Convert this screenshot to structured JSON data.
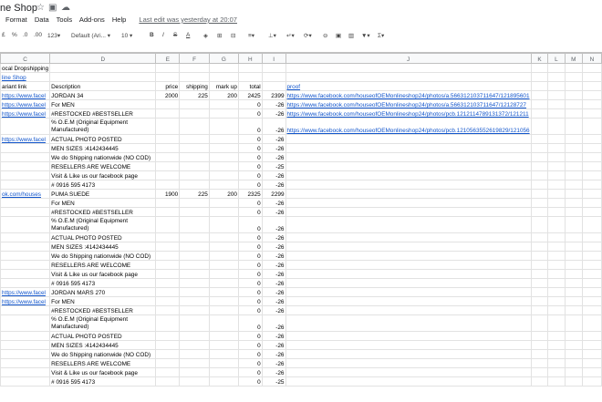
{
  "window": {
    "title": "ne Shop",
    "menus": [
      "Format",
      "Data",
      "Tools",
      "Add-ons",
      "Help"
    ],
    "last_edit": "Last edit was yesterday at 20:07"
  },
  "toolbar": {
    "pound": "£",
    "percent": "%",
    "dec_less": ".0",
    "dec_more": ".00",
    "format_more": "123▾",
    "font": "Default (Ari... ▾",
    "font_size": "10 ▾",
    "bold": "B",
    "italic": "I",
    "strike": "S",
    "text_color": "A",
    "fill": "◈",
    "borders": "⊞",
    "merge": "⊟",
    "align": "≡▾",
    "valign": "⊥▾",
    "wrap": "↵▾",
    "rotate": "⟳▾",
    "link": "⊖",
    "comment": "▣",
    "chart": "▥",
    "filter": "▼▾",
    "functions": "Σ▾"
  },
  "columns": [
    "C",
    "D",
    "E",
    "F",
    "G",
    "H",
    "I",
    "J",
    "K",
    "L",
    "M",
    "N"
  ],
  "rows": [
    {
      "c": "ocal Dropshipping",
      "d": "",
      "e": "",
      "f": "",
      "g": "",
      "h": "",
      "i": "",
      "j": "",
      "cl": false
    },
    {
      "c": "line Shop",
      "d": "",
      "e": "",
      "f": "",
      "g": "",
      "h": "",
      "i": "",
      "j": "",
      "cl": true
    },
    {
      "c": "ariant link",
      "d": "Description",
      "e": "price",
      "f": "shipping",
      "g": "mark up",
      "h": "total",
      "i": "",
      "j": "proof",
      "cl": false
    },
    {
      "c": "https://www.facel",
      "d": "JORDAN 34",
      "e": "2000",
      "f": "225",
      "g": "200",
      "h": "2425",
      "i": "2399",
      "j": "https://www.facebook.com/houseofOEMonlineshop24/photos/a.566312103711647/121895601",
      "cl": true
    },
    {
      "c": "https://www.facel",
      "d": "For MEN",
      "e": "",
      "f": "",
      "g": "",
      "h": "0",
      "i": "-26",
      "j": "https://www.facebook.com/houseofOEMonlineshop24/photos/a.566312103711647/12128727",
      "cl": true
    },
    {
      "c": "https://www.facel",
      "d": "#RESTOCKED #BESTSELLER",
      "e": "",
      "f": "",
      "g": "",
      "h": "0",
      "i": "-26",
      "j": "https://www.facebook.com/houseofOEMonlineshop24/photos/pcb.121211478913137​2/121211",
      "cl": true
    },
    {
      "c": "",
      "d": "% O.E.M (Original Equipment Manufactured)",
      "e": "",
      "f": "",
      "g": "",
      "h": "0",
      "i": "-26",
      "j": "https://www.facebook.com/houseofOEMonlineshop24/photos/pcb.121056355261982​9/121056",
      "cl": false,
      "tall": true
    },
    {
      "c": "https://www.facel",
      "d": "ACTUAL PHOTO POSTED",
      "e": "",
      "f": "",
      "g": "",
      "h": "0",
      "i": "-26",
      "j": "",
      "cl": true
    },
    {
      "c": "",
      "d": "MEN SIZES :4142434445",
      "e": "",
      "f": "",
      "g": "",
      "h": "0",
      "i": "-26",
      "j": "",
      "cl": false
    },
    {
      "c": "",
      "d": "We do Shipping nationwide (NO COD)",
      "e": "",
      "f": "",
      "g": "",
      "h": "0",
      "i": "-26",
      "j": "",
      "cl": false
    },
    {
      "c": "",
      "d": "RESELLERS ARE WELCOME",
      "e": "",
      "f": "",
      "g": "",
      "h": "0",
      "i": "-25",
      "j": "",
      "cl": false
    },
    {
      "c": "",
      "d": "Visit & Like us our facebook page",
      "e": "",
      "f": "",
      "g": "",
      "h": "0",
      "i": "-26",
      "j": "",
      "cl": false
    },
    {
      "c": "",
      "d": "# 0916 595 4173",
      "e": "",
      "f": "",
      "g": "",
      "h": "0",
      "i": "-26",
      "j": "",
      "cl": false
    },
    {
      "c": "ok.com/houses",
      "d": "PUMA SUEDE",
      "e": "1900",
      "f": "225",
      "g": "200",
      "h": "2325",
      "i": "2299",
      "j": "",
      "cl": true
    },
    {
      "c": "",
      "d": "For MEN",
      "e": "",
      "f": "",
      "g": "",
      "h": "0",
      "i": "-26",
      "j": "",
      "cl": false
    },
    {
      "c": "",
      "d": "#RESTOCKED #BESTSELLER",
      "e": "",
      "f": "",
      "g": "",
      "h": "0",
      "i": "-26",
      "j": "",
      "cl": false
    },
    {
      "c": "",
      "d": "% O.E.M (Original Equipment Manufactured)",
      "e": "",
      "f": "",
      "g": "",
      "h": "0",
      "i": "-26",
      "j": "",
      "cl": false,
      "tall": true
    },
    {
      "c": "",
      "d": "ACTUAL PHOTO POSTED",
      "e": "",
      "f": "",
      "g": "",
      "h": "0",
      "i": "-26",
      "j": "",
      "cl": false
    },
    {
      "c": "",
      "d": "MEN SIZES :4142434445",
      "e": "",
      "f": "",
      "g": "",
      "h": "0",
      "i": "-26",
      "j": "",
      "cl": false
    },
    {
      "c": "",
      "d": "We do Shipping nationwide (NO COD)",
      "e": "",
      "f": "",
      "g": "",
      "h": "0",
      "i": "-26",
      "j": "",
      "cl": false
    },
    {
      "c": "",
      "d": "RESELLERS ARE WELCOME",
      "e": "",
      "f": "",
      "g": "",
      "h": "0",
      "i": "-26",
      "j": "",
      "cl": false
    },
    {
      "c": "",
      "d": "Visit & Like us our facebook page",
      "e": "",
      "f": "",
      "g": "",
      "h": "0",
      "i": "-26",
      "j": "",
      "cl": false
    },
    {
      "c": "",
      "d": "# 0916 595 4173",
      "e": "",
      "f": "",
      "g": "",
      "h": "0",
      "i": "-26",
      "j": "",
      "cl": false
    },
    {
      "c": "https://www.facel",
      "d": "JORDAN MARS 270",
      "e": "",
      "f": "",
      "g": "",
      "h": "0",
      "i": "-26",
      "j": "",
      "cl": true
    },
    {
      "c": "https://www.facel",
      "d": "For MEN",
      "e": "",
      "f": "",
      "g": "",
      "h": "0",
      "i": "-26",
      "j": "",
      "cl": true
    },
    {
      "c": "",
      "d": "#RESTOCKED #BESTSELLER",
      "e": "",
      "f": "",
      "g": "",
      "h": "0",
      "i": "-26",
      "j": "",
      "cl": false
    },
    {
      "c": "",
      "d": "% O.E.M (Original Equipment Manufactured)",
      "e": "",
      "f": "",
      "g": "",
      "h": "0",
      "i": "-26",
      "j": "",
      "cl": false,
      "tall": true
    },
    {
      "c": "",
      "d": "ACTUAL PHOTO POSTED",
      "e": "",
      "f": "",
      "g": "",
      "h": "0",
      "i": "-26",
      "j": "",
      "cl": false
    },
    {
      "c": "",
      "d": "MEN SIZES :4142434445",
      "e": "",
      "f": "",
      "g": "",
      "h": "0",
      "i": "-26",
      "j": "",
      "cl": false
    },
    {
      "c": "",
      "d": "We do Shipping nationwide (NO COD)",
      "e": "",
      "f": "",
      "g": "",
      "h": "0",
      "i": "-26",
      "j": "",
      "cl": false
    },
    {
      "c": "",
      "d": "RESELLERS ARE WELCOME",
      "e": "",
      "f": "",
      "g": "",
      "h": "0",
      "i": "-26",
      "j": "",
      "cl": false
    },
    {
      "c": "",
      "d": "Visit & Like us our facebook page",
      "e": "",
      "f": "",
      "g": "",
      "h": "0",
      "i": "-26",
      "j": "",
      "cl": false
    },
    {
      "c": "",
      "d": "# 0916 595 4173",
      "e": "",
      "f": "",
      "g": "",
      "h": "0",
      "i": "-25",
      "j": "",
      "cl": false
    }
  ]
}
